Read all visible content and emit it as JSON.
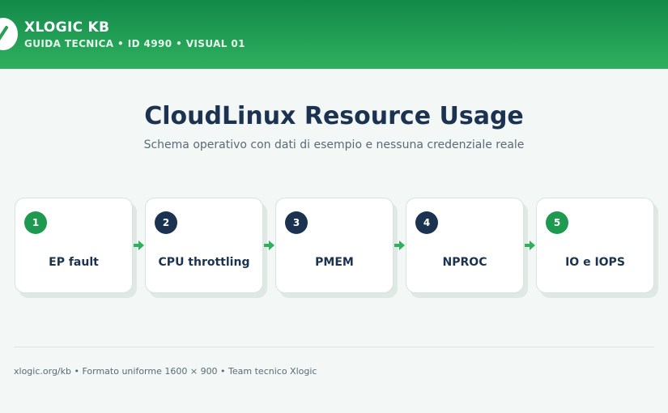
{
  "header": {
    "brand": "XLOGIC KB",
    "subtitle": "GUIDA TECNICA • ID 4990 • VISUAL 01",
    "colors": {
      "band_top": "#12894a",
      "band_bottom": "#2fb05e"
    }
  },
  "main": {
    "title": "CloudLinux Resource Usage",
    "subtitle": "Schema operativo con dati di esempio e nessuna credenziale reale"
  },
  "steps": [
    {
      "number": "1",
      "label": "EP fault",
      "badge_color": "#1e9a50"
    },
    {
      "number": "2",
      "label": "CPU throttling",
      "badge_color": "#1b3350"
    },
    {
      "number": "3",
      "label": "PMEM",
      "badge_color": "#1b3350"
    },
    {
      "number": "4",
      "label": "NPROC",
      "badge_color": "#1b3350"
    },
    {
      "number": "5",
      "label": "IO e IOPS",
      "badge_color": "#1e9a50"
    }
  ],
  "footer": {
    "text": "xlogic.org/kb • Formato uniforme 1600 × 900 • Team tecnico Xlogic"
  },
  "icons": {
    "logo": "check-mark-icon",
    "connector": "arrow-right-icon"
  }
}
